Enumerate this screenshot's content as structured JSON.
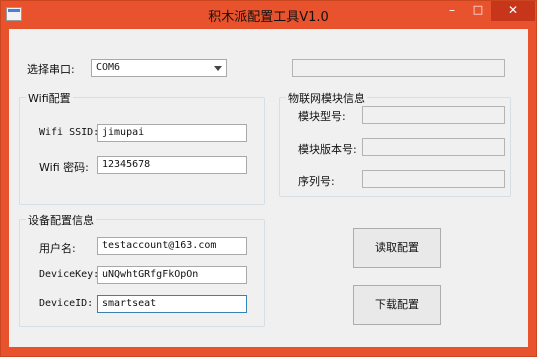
{
  "window": {
    "title": "积木派配置工具V1.0",
    "min_glyph": "–",
    "max_glyph": "□",
    "close_glyph": "✕"
  },
  "serial": {
    "label": "选择串口:",
    "selected": "COM6"
  },
  "wifi": {
    "group_title": "Wifi配置",
    "ssid_label": "Wifi SSID:",
    "ssid_value": "jimupai",
    "password_label": "Wifi 密码:",
    "password_value": "12345678"
  },
  "iot": {
    "group_title": "物联网模块信息",
    "model_label": "模块型号:",
    "model_value": "",
    "version_label": "模块版本号:",
    "version_value": "",
    "serial_label": "序列号:",
    "serial_value": ""
  },
  "device": {
    "group_title": "设备配置信息",
    "username_label": "用户名:",
    "username_value": "testaccount@163.com",
    "devicekey_label": "DeviceKey:",
    "devicekey_value": "uNQwhtGRfgFkOpOn",
    "deviceid_label": "DeviceID:",
    "deviceid_value": "smartseat"
  },
  "buttons": {
    "read_label": "读取配置",
    "download_label": "下载配置"
  },
  "colors": {
    "titlebar": "#e8522c",
    "client_bg": "#f0f0f0"
  }
}
